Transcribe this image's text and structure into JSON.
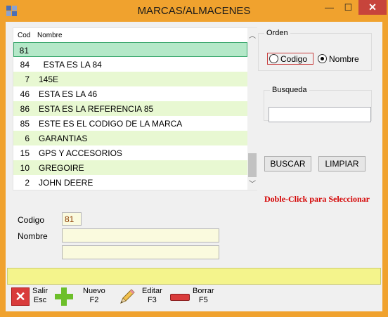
{
  "window": {
    "title": "MARCAS/ALMACENES",
    "minimize_glyph": "—",
    "maximize_glyph": "☐",
    "close_glyph": "✕"
  },
  "grid": {
    "columns": [
      "Cod",
      "Nombre"
    ],
    "rows": [
      {
        "cod": "81",
        "nombre": ""
      },
      {
        "cod": "84",
        "nombre": "  ESTA ES LA 84"
      },
      {
        "cod": "7",
        "nombre": "145E"
      },
      {
        "cod": "46",
        "nombre": "ESTA ES LA 46"
      },
      {
        "cod": "86",
        "nombre": "ESTA ES LA REFERENCIA 85"
      },
      {
        "cod": "85",
        "nombre": "ESTE ES EL CODIGO DE LA MARCA"
      },
      {
        "cod": "6",
        "nombre": "GARANTIAS"
      },
      {
        "cod": "15",
        "nombre": "GPS Y ACCESORIOS"
      },
      {
        "cod": "10",
        "nombre": "GREGOIRE"
      },
      {
        "cod": "2",
        "nombre": "JOHN DEERE"
      }
    ]
  },
  "orden": {
    "legend": "Orden",
    "codigo_label": "Codigo",
    "nombre_label": "Nombre",
    "selected": "Nombre"
  },
  "busqueda": {
    "legend": "Busqueda",
    "value": ""
  },
  "buttons": {
    "buscar": "BUSCAR",
    "limpiar": "LIMPIAR"
  },
  "hint": "Doble-Click para Seleccionar",
  "form": {
    "codigo_label": "Codigo",
    "codigo_value": "81",
    "nombre_label": "Nombre",
    "nombre_value": "",
    "nombre2_value": ""
  },
  "status": "",
  "toolbar": [
    {
      "label": "Salir",
      "key": "Esc",
      "icon": "close-x-icon"
    },
    {
      "label": "Nuevo",
      "key": "F2",
      "icon": "plus-icon"
    },
    {
      "label": "Editar",
      "key": "F3",
      "icon": "pencil-icon"
    },
    {
      "label": "Borrar",
      "key": "F5",
      "icon": "minus-icon"
    }
  ]
}
